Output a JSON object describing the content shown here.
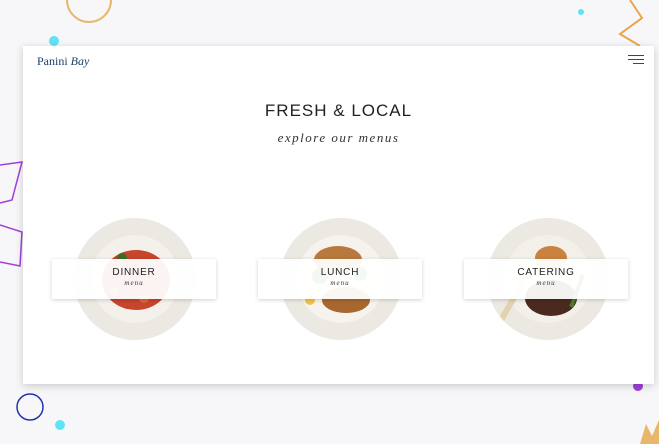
{
  "header": {
    "logo_line1": "Panini",
    "logo_line2": "Bay"
  },
  "hero": {
    "title": "FRESH & LOCAL",
    "subtitle": "explore our menus"
  },
  "menus": [
    {
      "label": "DINNER",
      "sub": "menu"
    },
    {
      "label": "LUNCH",
      "sub": "menu"
    },
    {
      "label": "CATERING",
      "sub": "menu"
    }
  ],
  "colors": {
    "logo": "#1e3f66",
    "accent_cyan": "#5fe3f5",
    "accent_purple": "#a040d8",
    "accent_gold": "#e8a64a"
  }
}
